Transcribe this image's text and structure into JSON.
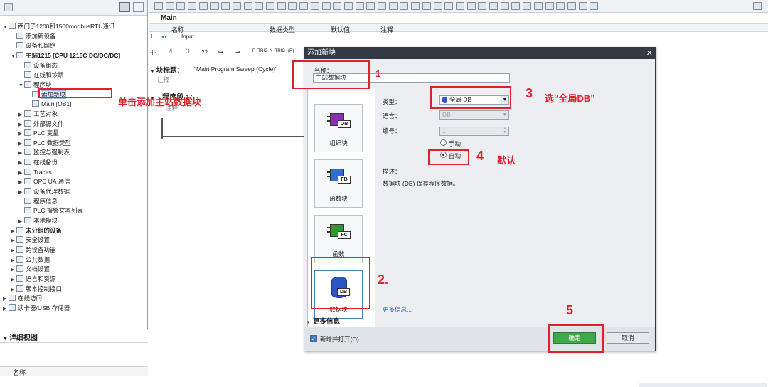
{
  "tree": {
    "items": [
      {
        "label": "西门子1200和1500modbusRTU通讯",
        "exp": "▼",
        "depth": 0
      },
      {
        "label": "添加新设备",
        "exp": "",
        "depth": 1
      },
      {
        "label": "设备和网络",
        "exp": "",
        "depth": 1
      },
      {
        "label": "主站1215 [CPU 1215C DC/DC/DC]",
        "exp": "▼",
        "depth": 1,
        "bold": true
      },
      {
        "label": "设备组态",
        "exp": "",
        "depth": 2
      },
      {
        "label": "在线和诊断",
        "exp": "",
        "depth": 2
      },
      {
        "label": "程序块",
        "exp": "▼",
        "depth": 2
      },
      {
        "label": "添加新块",
        "exp": "",
        "depth": 3,
        "sel": true
      },
      {
        "label": "Main [OB1]",
        "exp": "",
        "depth": 3
      },
      {
        "label": "工艺对象",
        "exp": "▶",
        "depth": 2
      },
      {
        "label": "外部源文件",
        "exp": "▶",
        "depth": 2
      },
      {
        "label": "PLC 变量",
        "exp": "▶",
        "depth": 2
      },
      {
        "label": "PLC 数据类型",
        "exp": "▶",
        "depth": 2
      },
      {
        "label": "监控与强制表",
        "exp": "▶",
        "depth": 2
      },
      {
        "label": "在线备份",
        "exp": "▶",
        "depth": 2
      },
      {
        "label": "Traces",
        "exp": "▶",
        "depth": 2
      },
      {
        "label": "OPC UA 通信",
        "exp": "▶",
        "depth": 2
      },
      {
        "label": "设备代理数据",
        "exp": "▶",
        "depth": 2
      },
      {
        "label": "程序信息",
        "exp": "",
        "depth": 2
      },
      {
        "label": "PLC 报警文本列表",
        "exp": "",
        "depth": 2
      },
      {
        "label": "本地模块",
        "exp": "▶",
        "depth": 2
      },
      {
        "label": "未分组的设备",
        "exp": "▶",
        "depth": 1,
        "bold": true
      },
      {
        "label": "安全设置",
        "exp": "▶",
        "depth": 1
      },
      {
        "label": "跨设备功能",
        "exp": "▶",
        "depth": 1
      },
      {
        "label": "公共数据",
        "exp": "▶",
        "depth": 1
      },
      {
        "label": "文档设置",
        "exp": "▶",
        "depth": 1
      },
      {
        "label": "语言和资源",
        "exp": "▶",
        "depth": 1
      },
      {
        "label": "版本控制接口",
        "exp": "▶",
        "depth": 1
      },
      {
        "label": "在线访问",
        "exp": "▶",
        "depth": 0
      },
      {
        "label": "读卡器/USB 存储器",
        "exp": "▶",
        "depth": 0
      }
    ],
    "annotation": "单击添加主站数据块"
  },
  "detail": {
    "title": "详细视图",
    "col": "名称"
  },
  "editor": {
    "tab_title": "Main",
    "cols": [
      "名称",
      "数据类型",
      "默认值",
      "注释"
    ],
    "row1": "Input",
    "ladder_labels": [
      "-||-",
      "-|/|-",
      "-( )-",
      "??",
      "↦",
      "⇀",
      "P_TRIG",
      "N_TRIG",
      "-(R)-"
    ],
    "block_title_label": "块标题：",
    "block_title_value": "\"Main Program Sweep (Cycle)\"",
    "comment": "注释",
    "network_label": "程序段 1：",
    "network_comment": "注释"
  },
  "dialog": {
    "title": "添加新块",
    "name_label": "名称：",
    "name_value": "主站数据块",
    "blocks": [
      {
        "tag": "OB",
        "label": "组织块",
        "color": "#8a2fb3"
      },
      {
        "tag": "FB",
        "label": "函数块",
        "color": "#2f6fd3"
      },
      {
        "tag": "FC",
        "label": "函数",
        "color": "#2e9a2e"
      },
      {
        "tag": "DB",
        "label": "数据块",
        "color": "#2e55c8"
      }
    ],
    "type_label": "类型：",
    "type_value": "全局 DB",
    "lang_label": "语言：",
    "lang_value": "DB",
    "number_label": "编号：",
    "number_value": "1",
    "manual_label": "手动",
    "auto_label": "自动",
    "desc_label": "描述：",
    "desc_text": "数据块 (DB) 保存程序数据。",
    "more_link": "更多信息...",
    "more_section": "更多信息",
    "open_label": "新增并打开(O)",
    "ok": "确定",
    "cancel": "取消"
  },
  "annotations": {
    "n1": "1",
    "n2": "2.",
    "n3": "3",
    "n3_text": "选“全局DB”",
    "n4": "4",
    "n4_text": "默认",
    "n5": "5"
  },
  "colors": {
    "red": "#e0202a",
    "dialog_title": "#333a44",
    "ok_green": "#3fa84a"
  }
}
